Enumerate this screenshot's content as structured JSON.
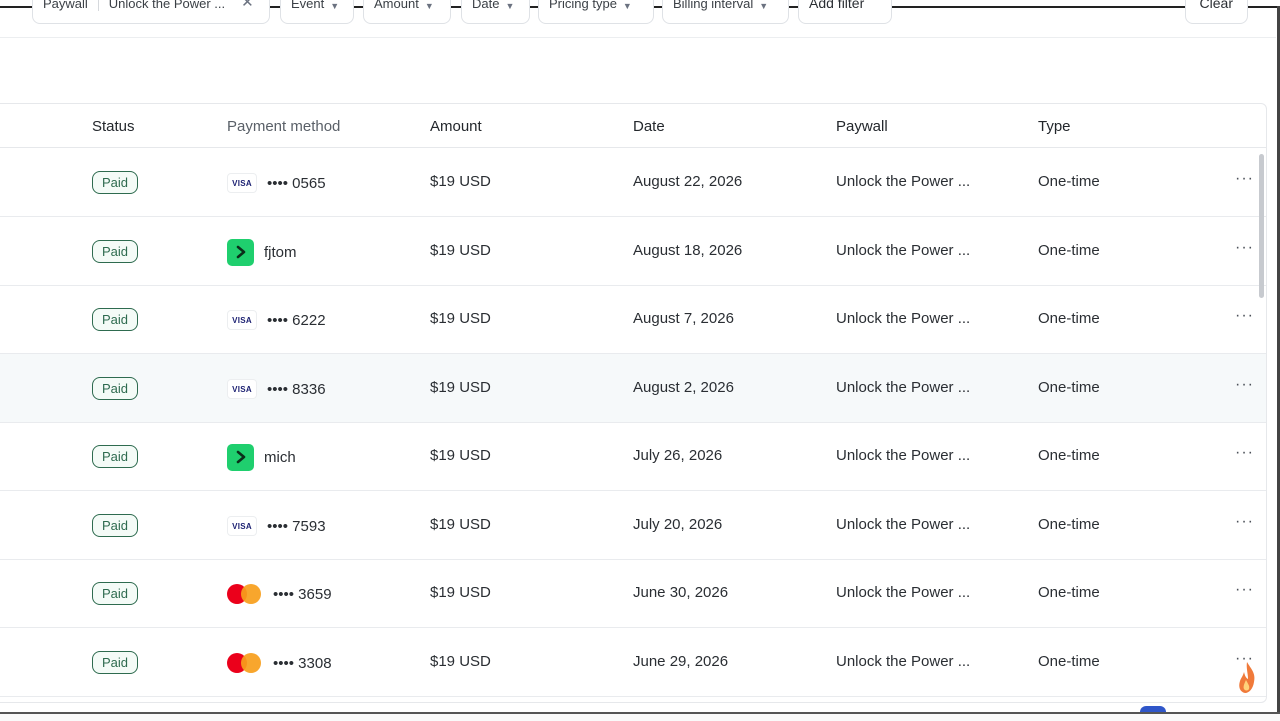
{
  "filters": {
    "paywall_label": "Paywall",
    "paywall_value": "Unlock the Power ...",
    "event_label": "Event",
    "amount_label": "Amount",
    "date_label": "Date",
    "pricing_type_label": "Pricing type",
    "billing_interval_label": "Billing interval",
    "add_filter_label": "Add filter",
    "clear_label": "Clear"
  },
  "table": {
    "headers": {
      "status": "Status",
      "payment_method": "Payment method",
      "amount": "Amount",
      "date": "Date",
      "paywall": "Paywall",
      "type": "Type"
    },
    "rows": [
      {
        "status": "Paid",
        "method_icon": "visa-icon",
        "method_text": "•••• 0565",
        "amount": "$19 USD",
        "date": "August 22, 2026",
        "paywall": "Unlock the Power ...",
        "type": "One-time",
        "more": "···"
      },
      {
        "status": "Paid",
        "method_icon": "link-icon",
        "method_text": "fjtom",
        "amount": "$19 USD",
        "date": "August 18, 2026",
        "paywall": "Unlock the Power ...",
        "type": "One-time",
        "more": "···"
      },
      {
        "status": "Paid",
        "method_icon": "visa-icon",
        "method_text": "•••• 6222",
        "amount": "$19 USD",
        "date": "August 7, 2026",
        "paywall": "Unlock the Power ...",
        "type": "One-time",
        "more": "···"
      },
      {
        "status": "Paid",
        "method_icon": "visa-icon",
        "method_text": "•••• 8336",
        "amount": "$19 USD",
        "date": "August 2, 2026",
        "paywall": "Unlock the Power ...",
        "type": "One-time",
        "more": "···"
      },
      {
        "status": "Paid",
        "method_icon": "link-icon",
        "method_text": "mich",
        "amount": "$19 USD",
        "date": "July 26, 2026",
        "paywall": "Unlock the Power ...",
        "type": "One-time",
        "more": "···"
      },
      {
        "status": "Paid",
        "method_icon": "visa-icon",
        "method_text": "•••• 7593",
        "amount": "$19 USD",
        "date": "July 20, 2026",
        "paywall": "Unlock the Power ...",
        "type": "One-time",
        "more": "···"
      },
      {
        "status": "Paid",
        "method_icon": "mastercard-icon",
        "method_text": "•••• 3659",
        "amount": "$19 USD",
        "date": "June 30, 2026",
        "paywall": "Unlock the Power ...",
        "type": "One-time",
        "more": "···"
      },
      {
        "status": "Paid",
        "method_icon": "mastercard-icon",
        "method_text": "•••• 3308",
        "amount": "$19 USD",
        "date": "June 29, 2026",
        "paywall": "Unlock the Power ...",
        "type": "One-time",
        "more": "···"
      }
    ]
  },
  "icons": {
    "visa_text": "VISA"
  },
  "colors": {
    "paid_badge": "#2e6b4f",
    "link_green": "#1fcf6e",
    "mastercard_red": "#eb001b",
    "mastercard_orange": "#f79e1b",
    "visa_blue": "#1a1f71"
  }
}
